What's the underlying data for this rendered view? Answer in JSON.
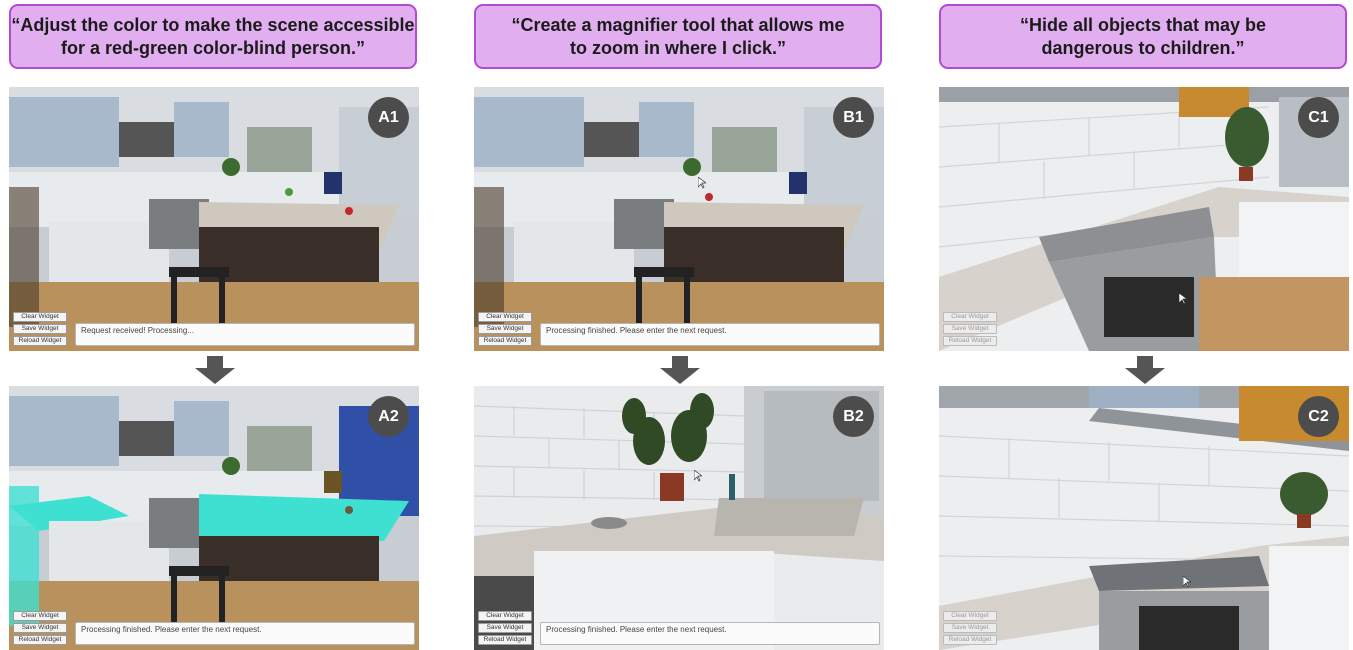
{
  "columns": [
    {
      "prompt": "“Adjust the color to make the scene accessible\nfor a red-green color-blind person.”",
      "top_badge": "A1",
      "bottom_badge": "A2",
      "top_status": "Request received! Processing...",
      "bottom_status": "Processing finished. Please enter the next request."
    },
    {
      "prompt": "“Create a magnifier tool that allows me\nto zoom in where I click.”",
      "top_badge": "B1",
      "bottom_badge": "B2",
      "top_status": "Processing finished. Please enter the next request.",
      "bottom_status": "Processing finished. Please enter the next request."
    },
    {
      "prompt": "“Hide all objects that may be\ndangerous to children.”",
      "top_badge": "C1",
      "bottom_badge": "C2",
      "top_status": "",
      "bottom_status": ""
    }
  ],
  "widgets": {
    "clear": "Clear Widget",
    "save": "Save Widget",
    "reload": "Reload Widget"
  },
  "colors": {
    "prompt_fill": "#e1aff0",
    "prompt_border": "#b34ad0",
    "badge": "#4c4c4c",
    "accessible_counter": "#3ee0d2",
    "arrow": "#555555"
  },
  "icons": [
    "down-arrow-icon",
    "cursor-icon"
  ]
}
